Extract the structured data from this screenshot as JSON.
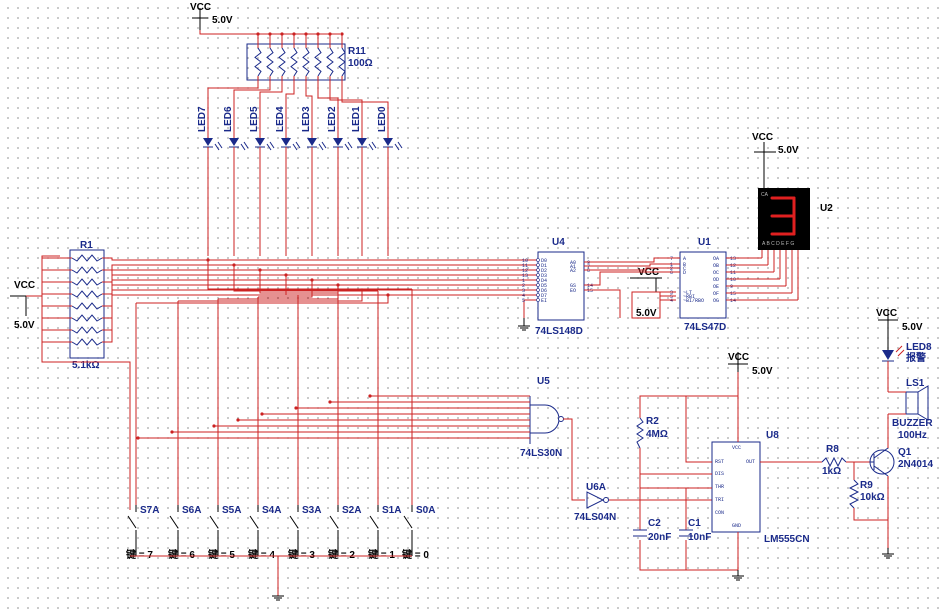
{
  "vcc": {
    "label": "VCC",
    "voltage": "5.0V"
  },
  "resistors": {
    "r11": {
      "ref": "R11",
      "value": "100Ω"
    },
    "r1": {
      "ref": "R1",
      "value": "5.1kΩ"
    },
    "r2": {
      "ref": "R2",
      "value": "4MΩ"
    },
    "r8": {
      "ref": "R8",
      "value": "1kΩ"
    },
    "r9": {
      "ref": "R9",
      "value": "10kΩ"
    }
  },
  "leds": [
    "LED7",
    "LED6",
    "LED5",
    "LED4",
    "LED3",
    "LED2",
    "LED1",
    "LED0"
  ],
  "led8": {
    "ref": "LED8",
    "text": "报警"
  },
  "chips": {
    "u4": {
      "ref": "U4",
      "part": "74LS148D"
    },
    "u1": {
      "ref": "U1",
      "part": "74LS47D"
    },
    "u2": {
      "ref": "U2",
      "display_digit": "3",
      "segment_labels": "A B C D E F G",
      "corner": "CA"
    },
    "u5": {
      "ref": "U5",
      "part": "74LS30N"
    },
    "u6": {
      "ref": "U6A",
      "part": "74LS04N"
    },
    "u8": {
      "ref": "U8",
      "part": "LM555CN"
    }
  },
  "u4_pins_left": [
    "10",
    "11",
    "12",
    "13",
    "1",
    "2",
    "3",
    "4",
    "5"
  ],
  "u4_names_left": [
    "D0",
    "D1",
    "D2",
    "D3",
    "D4",
    "D5",
    "D6",
    "D7",
    "EI"
  ],
  "u4_pins_right": [
    "9",
    "7",
    "6",
    "14",
    "15"
  ],
  "u4_names_right": [
    "A0",
    "A1",
    "A2",
    "GS",
    "EO"
  ],
  "u1_pins_left": [
    "7",
    "1",
    "2",
    "6",
    "3",
    "5",
    "4"
  ],
  "u1_names_left": [
    "A",
    "B",
    "C",
    "D",
    "~LT",
    "~RBI",
    "~BI/RBO"
  ],
  "u1_pins_right": [
    "13",
    "12",
    "11",
    "10",
    "9",
    "15",
    "14"
  ],
  "u1_names_right": [
    "OA",
    "OB",
    "OC",
    "OD",
    "OE",
    "OF",
    "OG"
  ],
  "u8_pins": {
    "vcc": "VCC",
    "rst": "RST",
    "dis": "DIS",
    "thr": "THR",
    "tri": "TRI",
    "con": "CON",
    "gnd": "GND",
    "out": "OUT"
  },
  "capacitors": {
    "c2": {
      "ref": "C2",
      "value": "20nF"
    },
    "c1": {
      "ref": "C1",
      "value": "10nF"
    }
  },
  "buzzer": {
    "ref": "LS1",
    "part": "BUZZER",
    "freq": "100Hz"
  },
  "transistor": {
    "ref": "Q1",
    "part": "2N4014"
  },
  "switches": [
    "S7A",
    "S6A",
    "S5A",
    "S4A",
    "S3A",
    "S2A",
    "S1A",
    "S0A"
  ],
  "keys": [
    "键 = 7",
    "键 = 6",
    "键 = 5",
    "键 = 4",
    "键 = 3",
    "键 = 2",
    "键 = 1",
    "键 = 0"
  ]
}
